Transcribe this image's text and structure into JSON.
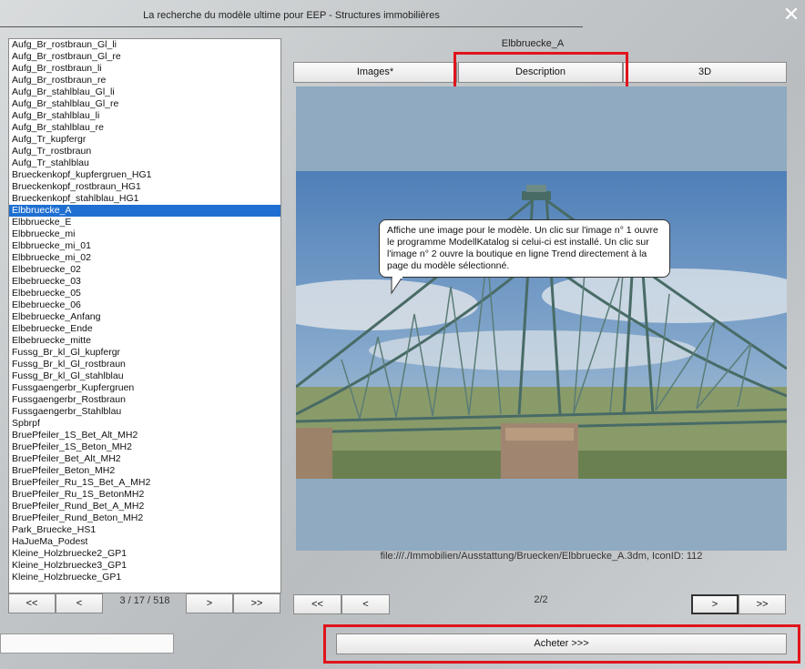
{
  "window": {
    "title": "La recherche du modèle ultime pour EEP - Structures immobilières",
    "close_glyph": "✕"
  },
  "model_list": {
    "selected_index": 15,
    "items": [
      "Aufg_Br_rostbraun_Gl_li",
      "Aufg_Br_rostbraun_Gl_re",
      "Aufg_Br_rostbraun_li",
      "Aufg_Br_rostbraun_re",
      "Aufg_Br_stahlblau_Gl_li",
      "Aufg_Br_stahlblau_Gl_re",
      "Aufg_Br_stahlblau_li",
      "Aufg_Br_stahlblau_re",
      "Aufg_Tr_kupfergr",
      "Aufg_Tr_rostbraun",
      "Aufg_Tr_stahlblau",
      "Brueckenkopf_kupfergruen_HG1",
      "Brueckenkopf_rostbraun_HG1",
      "Brueckenkopf_stahlblau_HG1",
      "Elbbruecke_A",
      "Elbbruecke_E",
      "Elbbruecke_mi",
      "Elbbruecke_mi_01",
      "Elbbruecke_mi_02",
      "Elbebruecke_02",
      "Elbebruecke_03",
      "Elbebruecke_05",
      "Elbebruecke_06",
      "Elbebruecke_Anfang",
      "Elbebruecke_Ende",
      "Elbebruecke_mitte",
      "Fussg_Br_kl_Gl_kupfergr",
      "Fussg_Br_kl_Gl_rostbraun",
      "Fussg_Br_kl_Gl_stahlblau",
      "Fussgaengerbr_Kupfergruen",
      "Fussgaengerbr_Rostbraun",
      "Fussgaengerbr_Stahlblau",
      "Spbrpf",
      "BruePfeiler_1S_Bet_Alt_MH2",
      "BruePfeiler_1S_Beton_MH2",
      "BruePfeiler_Bet_Alt_MH2",
      "BruePfeiler_Beton_MH2",
      "BruePfeiler_Ru_1S_Bet_A_MH2",
      "BruePfeiler_Ru_1S_BetonMH2",
      "BruePfeiler_Rund_Bet_A_MH2",
      "BruePfeiler_Rund_Beton_MH2",
      "Park_Bruecke_HS1",
      "HaJueMa_Podest",
      "Kleine_Holzbruecke2_GP1",
      "Kleine_Holzbruecke3_GP1",
      "Kleine_Holzbruecke_GP1"
    ]
  },
  "list_nav": {
    "first": "<<",
    "prev": "<",
    "counter": "3 / 17 / 518",
    "next": ">",
    "last": ">>"
  },
  "detail": {
    "model_name": "Elbbruecke_A",
    "tabs": [
      "Images*",
      "Description",
      "3D"
    ],
    "active_tab": "Images*",
    "tooltip": "Affiche une image pour le modèle. Un clic sur l'image n° 1 ouvre le programme ModellKatalog si celui-ci est installé. Un clic sur l'image n° 2 ouvre la boutique en ligne Trend directement à la page du modèle sélectionné.",
    "file_path": "file:///./Immobilien/Ausstattung/Bruecken/Elbbruecke_A.3dm, IconID: 112"
  },
  "image_nav": {
    "first": "<<",
    "prev": "<",
    "counter": "2/2",
    "next": ">",
    "last": ">>"
  },
  "buy_button": "Acheter >>>",
  "colors": {
    "selection": "#1e6fd1",
    "highlight": "#e0141c",
    "sky": "#8faac1"
  }
}
